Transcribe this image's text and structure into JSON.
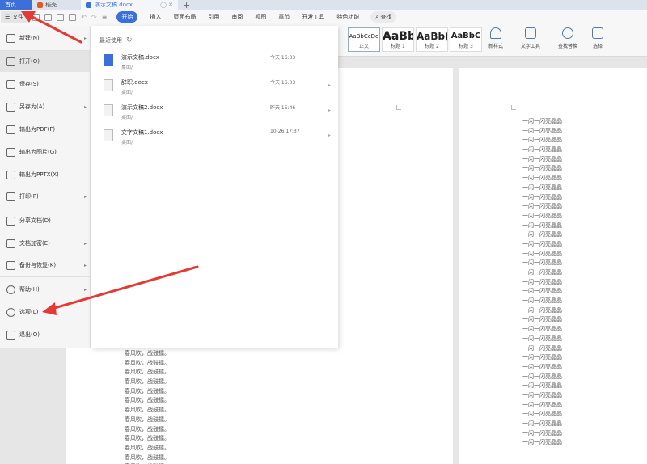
{
  "tabs": {
    "home": "首页",
    "app": "稻壳",
    "doc": "演示文稿.docx",
    "add": "+"
  },
  "menubar": {
    "file": "文件",
    "items": [
      "开始",
      "插入",
      "页面布局",
      "引用",
      "审阅",
      "视图",
      "章节",
      "开发工具",
      "特色功能"
    ],
    "active_index": 0,
    "search": "查找"
  },
  "styles": [
    {
      "sample": "AaBbCcDd",
      "name": "正文"
    },
    {
      "sample": "AaBb",
      "name": "标题 1"
    },
    {
      "sample": "AaBb(",
      "name": "标题 2"
    },
    {
      "sample": "AaBbC",
      "name": "标题 3"
    }
  ],
  "tools": {
    "new_style": "新样式",
    "text_tool": "文字工具",
    "find_replace": "查找替换",
    "select": "选择"
  },
  "file_menu": [
    {
      "label": "新建(N)",
      "arrow": true
    },
    {
      "label": "打开(O)",
      "arrow": false
    },
    {
      "label": "保存(S)",
      "arrow": false
    },
    {
      "label": "另存为(A)",
      "arrow": true
    },
    {
      "label": "输出为PDF(F)",
      "arrow": false
    },
    {
      "label": "输出为图片(G)",
      "arrow": false
    },
    {
      "label": "输出为PPTX(X)",
      "arrow": false
    },
    {
      "label": "打印(P)",
      "arrow": true
    },
    {
      "label": "分享文档(D)",
      "arrow": false
    },
    {
      "label": "文档加密(E)",
      "arrow": true
    },
    {
      "label": "备份与恢复(K)",
      "arrow": true
    },
    {
      "label": "帮助(H)",
      "arrow": true
    },
    {
      "label": "选项(L)",
      "arrow": false
    },
    {
      "label": "退出(Q)",
      "arrow": false
    }
  ],
  "recent": {
    "title": "最近使用",
    "items": [
      {
        "name": "演示文稿.docx",
        "path": "桌面/",
        "time": "今天 16:33"
      },
      {
        "name": "辞职.docx",
        "path": "桌面/",
        "time": "今天 16:03"
      },
      {
        "name": "演示文稿2.docx",
        "path": "桌面/",
        "time": "昨天 15:46"
      },
      {
        "name": "文字文稿1.docx",
        "path": "桌面/",
        "time": "10-26 17:37"
      }
    ]
  },
  "doc_text": {
    "left_line": "春风吹，战鼓擂。",
    "left_count": 13,
    "right_line": "一闪一闪亮晶晶",
    "right_count": 35
  },
  "colors": {
    "accent": "#3d6fd9",
    "arrow": "#e53935"
  }
}
